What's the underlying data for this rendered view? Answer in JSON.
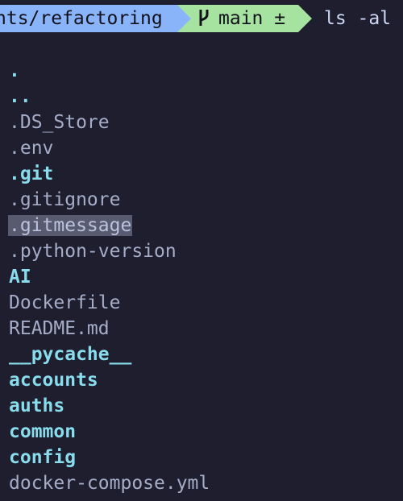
{
  "prompt": {
    "path": "nts/refactoring",
    "branch_icon": "git-branch-icon",
    "branch": "main ±",
    "command": "ls -al"
  },
  "colors": {
    "background": "#1e1e2e",
    "path_segment": "#89b4fa",
    "git_segment": "#a6e3a1",
    "directory": "#89dceb",
    "file": "#a6adc8",
    "selection": "#585b70"
  },
  "entries": [
    {
      "name": ".",
      "type": "dir"
    },
    {
      "name": "..",
      "type": "dir"
    },
    {
      "name": ".DS_Store",
      "type": "file"
    },
    {
      "name": ".env",
      "type": "file"
    },
    {
      "name": ".git",
      "type": "dir"
    },
    {
      "name": ".gitignore",
      "type": "file"
    },
    {
      "name": ".gitmessage",
      "type": "file",
      "selected": true
    },
    {
      "name": ".python-version",
      "type": "file"
    },
    {
      "name": "AI",
      "type": "dir"
    },
    {
      "name": "Dockerfile",
      "type": "file"
    },
    {
      "name": "README.md",
      "type": "file"
    },
    {
      "name": "__pycache__",
      "type": "dir"
    },
    {
      "name": "accounts",
      "type": "dir"
    },
    {
      "name": "auths",
      "type": "dir"
    },
    {
      "name": "common",
      "type": "dir"
    },
    {
      "name": "config",
      "type": "dir"
    },
    {
      "name": "docker-compose.yml",
      "type": "file"
    }
  ]
}
